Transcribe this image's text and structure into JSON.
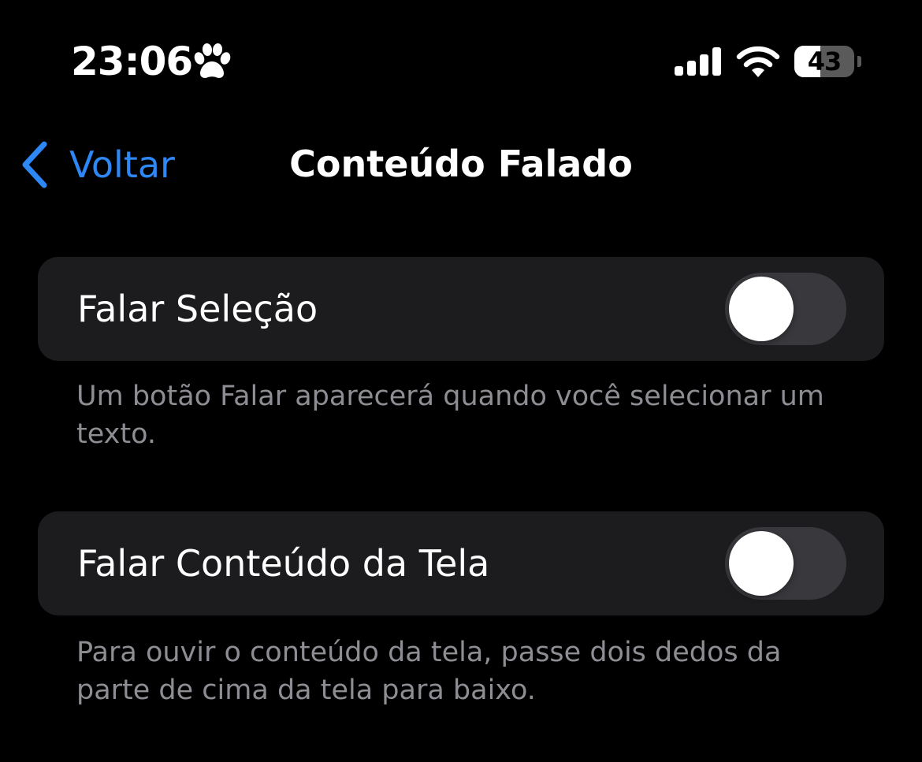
{
  "status_bar": {
    "time": "23:06",
    "battery_level": "43",
    "battery_percent": 43,
    "icons": [
      "paw-icon",
      "cellular-signal-icon",
      "wifi-icon",
      "battery-icon"
    ]
  },
  "nav": {
    "back_label": "Voltar",
    "title": "Conteúdo Falado",
    "accent_color": "#2d87f5"
  },
  "settings": [
    {
      "label": "Falar Seleção",
      "enabled": false,
      "footer": "Um botão Falar aparecerá quando você selecionar um texto."
    },
    {
      "label": "Falar Conteúdo da Tela",
      "enabled": false,
      "footer": "Para ouvir o conteúdo da tela, passe dois dedos da parte de cima da tela para baixo."
    }
  ],
  "colors": {
    "background": "#000000",
    "group_background": "#1c1c1e",
    "toggle_off": "#39393d",
    "footer_text": "#8d8d93"
  }
}
